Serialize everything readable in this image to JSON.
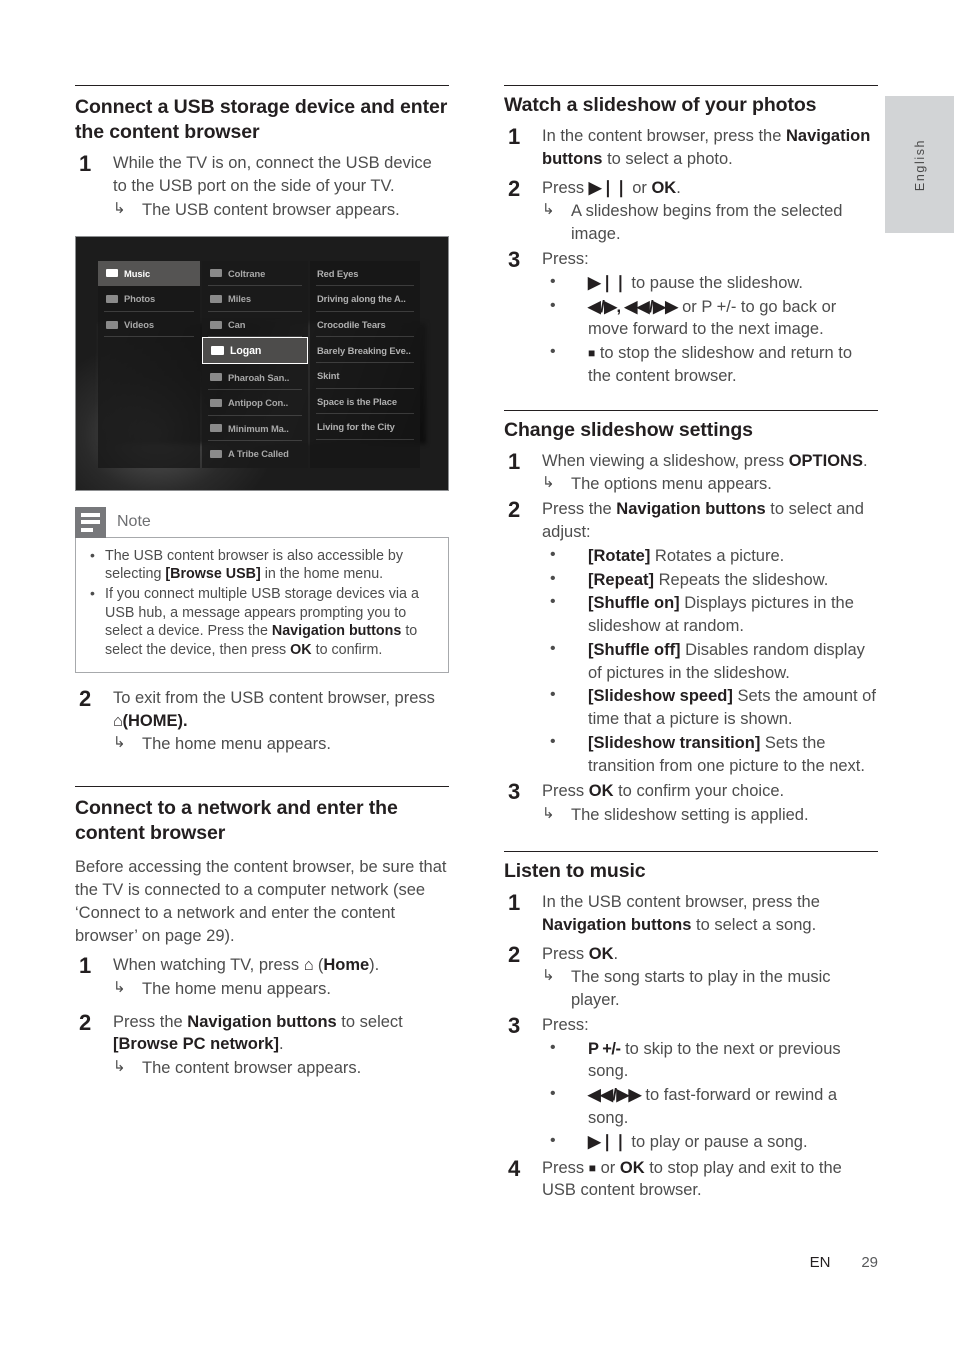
{
  "language_tab": {
    "label": "English"
  },
  "footer": {
    "lang_code": "EN",
    "page_number": "29"
  },
  "left_column": {
    "section1": {
      "title": "Connect a USB storage device and enter the content browser",
      "step1_num": "1",
      "step1_text": "While the TV is on, connect the USB device to the USB port on the side of your TV.",
      "step1_result": "The USB content browser appears.",
      "step2_num": "2",
      "step2_text_a": "To exit from the USB content browser, press ",
      "step2_home_icon": "⌂",
      "step2_text_b": "(HOME).",
      "step2_result": "The home menu appears."
    },
    "note": {
      "title": "Note",
      "bullet1_a": "The USB content browser is also accessible by selecting ",
      "bullet1_b": "[Browse USB]",
      "bullet1_c": " in the home menu.",
      "bullet2_a": "If you connect multiple USB storage devices via a USB hub, a message appears prompting you to select a device. Press the ",
      "bullet2_b": "Navigation buttons",
      "bullet2_c": " to select the device, then press ",
      "bullet2_d": "OK",
      "bullet2_e": " to confirm."
    },
    "section2": {
      "title": "Connect to a network and enter the content browser",
      "intro": "Before accessing the content browser, be sure that the TV is connected to a computer network (see ‘Connect to a network and enter the content browser’ on page 29).",
      "step1_num": "1",
      "step1_text_a": "When watching TV, press ",
      "step1_home_icon": "⌂",
      "step1_text_b": " (",
      "step1_bold": "Home",
      "step1_text_c": ").",
      "step1_result": "The home menu appears.",
      "step2_num": "2",
      "step2_text_a": "Press the ",
      "step2_bold": "Navigation buttons",
      "step2_text_b": " to select ",
      "step2_bold2": "[Browse PC network]",
      "step2_text_c": ".",
      "step2_result": "The content browser appears."
    },
    "tv_screenshot": {
      "column1": [
        {
          "label": "Music",
          "state": "selected"
        },
        {
          "label": "Photos",
          "state": "normal"
        },
        {
          "label": "Videos",
          "state": "normal"
        }
      ],
      "column2": [
        {
          "label": "Coltrane",
          "state": "normal"
        },
        {
          "label": "Miles",
          "state": "normal"
        },
        {
          "label": "Can",
          "state": "normal"
        },
        {
          "label": "Logan",
          "state": "highlighted"
        },
        {
          "label": "Pharoah San..",
          "state": "normal"
        },
        {
          "label": "Antipop Con..",
          "state": "normal"
        },
        {
          "label": "Minimum Ma..",
          "state": "normal"
        },
        {
          "label": "A Tribe Called",
          "state": "normal"
        }
      ],
      "column3": [
        "Red Eyes",
        "Driving along the A..",
        "Crocodile Tears",
        "Barely Breaking Eve..",
        "Skint",
        "Space is the Place",
        "Living for the City"
      ]
    }
  },
  "right_column": {
    "section1": {
      "title": "Watch a slideshow of your photos",
      "step1_num": "1",
      "step1_text_a": "In the content browser, press the ",
      "step1_bold": "Navigation buttons",
      "step1_text_b": " to select a photo.",
      "step2_num": "2",
      "step2_text_a": "Press ",
      "step2_sym": "▶❘❘",
      "step2_text_b": " or ",
      "step2_bold": "OK",
      "step2_text_c": ".",
      "step2_result": "A slideshow begins from the selected image.",
      "step3_num": "3",
      "step3_text": "Press:",
      "step3_bullets": [
        {
          "sym": "▶❘❘",
          "text": " to pause the slideshow."
        },
        {
          "sym": "◀/▶, ◀◀/▶▶",
          "text": " or P +/- to go back or move forward to the next image."
        },
        {
          "sym": "■",
          "text": " to stop the slideshow and return to the content browser."
        }
      ]
    },
    "section2": {
      "title": "Change slideshow settings",
      "step1_num": "1",
      "step1_text_a": "When viewing a slideshow, press ",
      "step1_bold": "OPTIONS",
      "step1_text_b": ".",
      "step1_result": "The options menu appears.",
      "step2_num": "2",
      "step2_text_a": "Press the ",
      "step2_bold": "Navigation buttons",
      "step2_text_b": " to select and adjust:",
      "step2_bullets": [
        {
          "bold": "[Rotate]",
          "text": " Rotates a picture."
        },
        {
          "bold": "[Repeat]",
          "text": " Repeats the slideshow."
        },
        {
          "bold": "[Shuffle on]",
          "text": " Displays pictures in the slideshow at random."
        },
        {
          "bold": "[Shuffle off]",
          "text": " Disables random display of pictures in the slideshow."
        },
        {
          "bold": "[Slideshow speed]",
          "text": " Sets the amount of time that a picture is shown."
        },
        {
          "bold": "[Slideshow transition]",
          "text": " Sets the transition from one picture to the next."
        }
      ],
      "step3_num": "3",
      "step3_text_a": "Press ",
      "step3_bold": "OK",
      "step3_text_b": " to confirm your choice.",
      "step3_result": "The slideshow setting is applied."
    },
    "section3": {
      "title": "Listen to music",
      "step1_num": "1",
      "step1_text_a": "In the USB content browser, press the ",
      "step1_bold": "Navigation buttons",
      "step1_text_b": " to select a song.",
      "step2_num": "2",
      "step2_text_a": "Press ",
      "step2_bold": "OK",
      "step2_text_b": ".",
      "step2_result": "The song starts to play in the music player.",
      "step3_num": "3",
      "step3_text": "Press:",
      "step3_bullets": [
        {
          "sym": "P +/-",
          "text": " to skip to the next or previous song."
        },
        {
          "sym": "◀◀/▶▶",
          "text": " to fast-forward or rewind a song."
        },
        {
          "sym": "▶❘❘",
          "text": " to play or pause a song."
        }
      ],
      "step4_num": "4",
      "step4_text_a": "Press ",
      "step4_sym": "■",
      "step4_text_b": " or ",
      "step4_bold": "OK",
      "step4_text_c": " to stop play and exit to the USB content browser."
    }
  }
}
